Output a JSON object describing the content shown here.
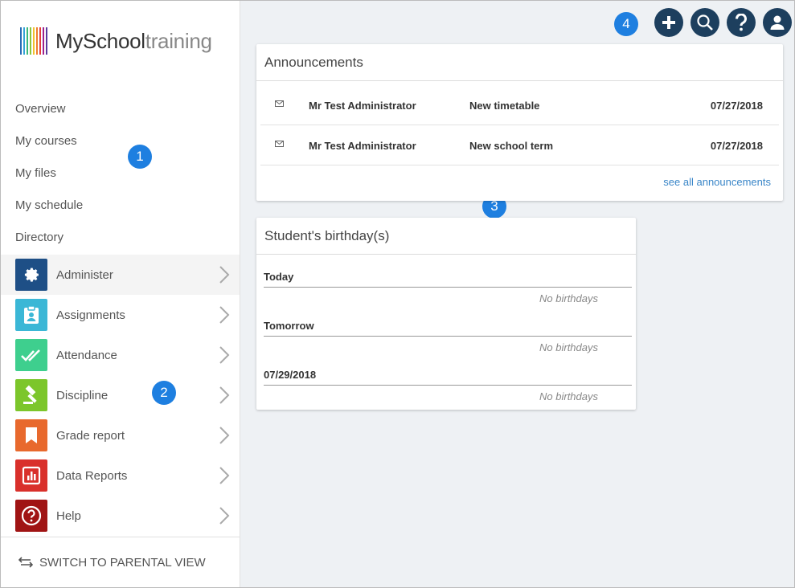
{
  "logo": {
    "name_bold": "MySchool",
    "name_light": "training"
  },
  "nav": {
    "links": [
      "Overview",
      "My courses",
      "My files",
      "My schedule",
      "Directory"
    ],
    "modules": [
      {
        "label": "Administer",
        "icon": "gear-icon",
        "color": "#1e4f86"
      },
      {
        "label": "Assignments",
        "icon": "assignment-icon",
        "color": "#3bb7d6"
      },
      {
        "label": "Attendance",
        "icon": "double-check-icon",
        "color": "#3ecf8e"
      },
      {
        "label": "Discipline",
        "icon": "gavel-icon",
        "color": "#7cc62b"
      },
      {
        "label": "Grade report",
        "icon": "bookmark-icon",
        "color": "#e8692d"
      },
      {
        "label": "Data Reports",
        "icon": "bar-chart-icon",
        "color": "#d9302b"
      },
      {
        "label": "Help",
        "icon": "help-circle-icon",
        "color": "#a01414"
      }
    ],
    "switch_label": "SWITCH TO PARENTAL VIEW"
  },
  "badges": [
    "1",
    "2",
    "3",
    "4"
  ],
  "announcements": {
    "title": "Announcements",
    "rows": [
      {
        "from": "Mr Test Administrator",
        "subject": "New timetable",
        "date": "07/27/2018"
      },
      {
        "from": "Mr Test Administrator",
        "subject": "New school term",
        "date": "07/27/2018"
      }
    ],
    "see_all": "see all announcements"
  },
  "birthdays": {
    "title": "Student's birthday(s)",
    "sections": [
      {
        "heading": "Today",
        "message": "No birthdays"
      },
      {
        "heading": "Tomorrow",
        "message": "No birthdays"
      },
      {
        "heading": "07/29/2018",
        "message": "No birthdays"
      }
    ]
  },
  "colors": {
    "accent": "#1e7fe0",
    "topbar_icon": "#1d3f5e",
    "link": "#3a86c8"
  }
}
